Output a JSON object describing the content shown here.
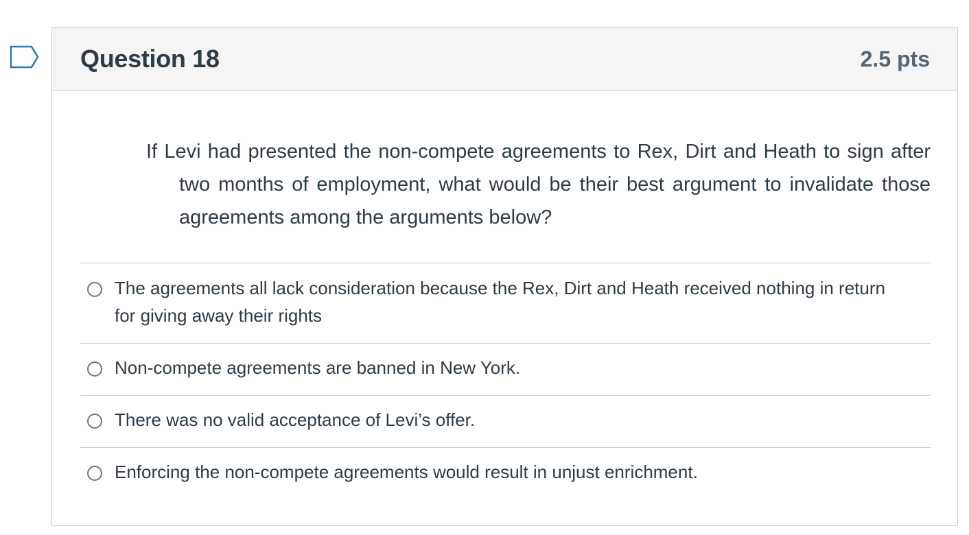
{
  "question": {
    "title": "Question 18",
    "points": "2.5 pts",
    "text": "If Levi had presented the non-compete agreements to Rex, Dirt and Heath to sign after two months of employment, what would be their best argument to invalidate those agreements among the arguments below?"
  },
  "answers": [
    {
      "label": "The agreements all lack consideration because the Rex, Dirt and Heath received nothing in return for giving away their rights"
    },
    {
      "label": "Non-compete agreements are banned in New York."
    },
    {
      "label": "There was no valid acceptance of Levi’s offer."
    },
    {
      "label": "Enforcing the non-compete agreements would result in unjust enrichment."
    }
  ],
  "colors": {
    "header_bg": "#f5f5f5",
    "border": "#c7cdd1",
    "text": "#2d3b45",
    "points_text": "#556572",
    "flag_stroke": "#2b7abc"
  },
  "icons": {
    "flag": "flag-question-icon",
    "radio": "radio-unselected-icon"
  }
}
